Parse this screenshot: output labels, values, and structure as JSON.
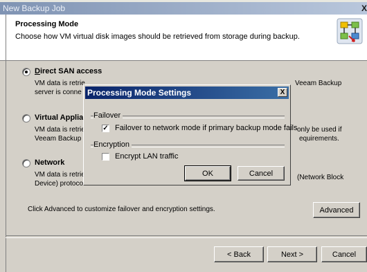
{
  "window": {
    "title": "New Backup Job",
    "close_glyph": "X"
  },
  "header": {
    "title": "Processing Mode",
    "description": "Choose how VM virtual disk images should be retrieved from storage during backup.",
    "icon": "processing-mode-icon"
  },
  "options": [
    {
      "label": "Direct SAN access",
      "selected": true,
      "desc_line1": "VM data is retrieved using vStorage API directly from SAN. This mode requires that Veeam Backup",
      "desc_line2": "server is connected..."
    },
    {
      "label": "Virtual Appliance",
      "selected": false,
      "desc_line1": "VM data is retrieved ... only be used if",
      "desc_line2": "Veeam Backup ... requirements."
    },
    {
      "label": "Network",
      "selected": false,
      "desc_line1": "VM data is retrieved ... (Network Block",
      "desc_line2": "Device) protocol"
    }
  ],
  "option_fragments": {
    "direct_desc_right": "Veeam Backup",
    "direct_desc_left1": "VM data is retrie",
    "direct_desc_left2": "server is conne",
    "va_label_visible": "Virtual Applia",
    "va_desc_left1": "VM data is retrie",
    "va_desc_left2": "Veeam Backup",
    "va_desc_right1": "only be used if",
    "va_desc_right2": "equirements.",
    "net_label": "Network",
    "net_desc_left1": "VM data is retrie",
    "net_desc_left2": "Device) protoco",
    "net_desc_right1": "(Network Block"
  },
  "hint": "Click Advanced to customize failover and encryption settings.",
  "buttons": {
    "advanced": "Advanced",
    "back": "< Back",
    "next": "Next >",
    "cancel": "Cancel"
  },
  "dialog": {
    "title": "Processing Mode Settings",
    "close_glyph": "X",
    "failover_group": "Failover",
    "failover_label": "Failover to network mode if primary backup mode fails",
    "failover_checked": true,
    "encryption_group": "Encryption",
    "encrypt_label": "Encrypt LAN traffic",
    "encrypt_checked": false,
    "ok": "OK",
    "cancel": "Cancel"
  }
}
